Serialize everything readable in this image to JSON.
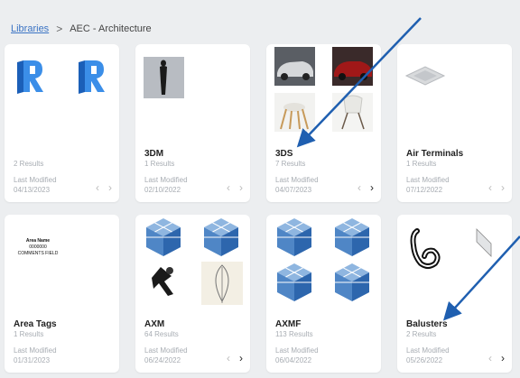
{
  "breadcrumb": {
    "root": "Libraries",
    "separator": ">",
    "current": "AEC - Architecture"
  },
  "last_modified_label": "Last Modified",
  "cards": [
    {
      "name": "",
      "count": "2 Results",
      "date": "04/13/2023"
    },
    {
      "name": "3DM",
      "count": "1 Results",
      "date": "02/10/2022"
    },
    {
      "name": "3DS",
      "count": "7 Results",
      "date": "04/07/2023"
    },
    {
      "name": "Air Terminals",
      "count": "1 Results",
      "date": "07/12/2022"
    },
    {
      "name": "Area Tags",
      "count": "1 Results",
      "date": "01/31/2023"
    },
    {
      "name": "AXM",
      "count": "64 Results",
      "date": "06/24/2022"
    },
    {
      "name": "AXMF",
      "count": "113 Results",
      "date": "06/04/2022"
    },
    {
      "name": "Balusters",
      "count": "2 Results",
      "date": "05/26/2022"
    }
  ],
  "area_tag_thumb": {
    "line1": "Area Name",
    "line2": "0000000",
    "line3": "COMMENTS FIELD"
  },
  "colors": {
    "revit_blue": "#2f7fd8",
    "arrow_blue": "#1f5fb0",
    "link_blue": "#3a73c4"
  }
}
